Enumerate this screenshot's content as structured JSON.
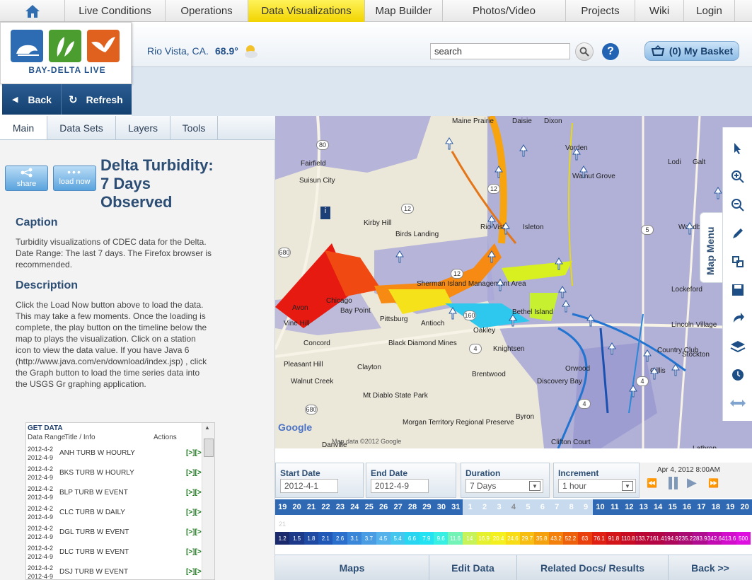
{
  "nav": {
    "items": [
      "Live Conditions",
      "Operations",
      "Data Visualizations",
      "Map Builder",
      "Photos/Video",
      "Projects",
      "Wiki",
      "Login"
    ],
    "active": "Data Visualizations"
  },
  "brand": {
    "name": "BAY-DELTA LIVE"
  },
  "header": {
    "location": "Rio Vista, CA.",
    "temperature": "68.9°",
    "search_placeholder": "search",
    "basket": "(0) My Basket"
  },
  "actions": {
    "back": "Back",
    "refresh": "Refresh"
  },
  "left_tabs": [
    "Main",
    "Data Sets",
    "Layers",
    "Tools"
  ],
  "buttons": {
    "share": "share",
    "load_now": "load now"
  },
  "main": {
    "title_line1": "Delta Turbidity:",
    "title_line2": "7 Days",
    "title_line3": "Observed",
    "caption_heading": "Caption",
    "caption_lines": [
      "Turbidity visualizations of CDEC data for the Delta.",
      "Date Range: The last 7 days. The Firefox browser is",
      "recommended."
    ],
    "description_heading": "Description",
    "description_lines": [
      "Click the Load Now button above to load the data.",
      "This may take a few moments. Once the loading is",
      "complete, the play button on the timeline below the",
      "map to plays the visualization. Click on a station",
      "icon to view the data value. If you have Java 6",
      "(http://www.java.com/en/download/index.jsp) , click",
      "the Graph button to load the time series data into",
      "the USGS Gr graphing application."
    ]
  },
  "get_data": {
    "title": "GET DATA",
    "columns": [
      "Data Range",
      "Title / Info",
      "Actions"
    ],
    "rows": [
      {
        "start": "2012-4-2",
        "end": "2012-4-9",
        "title": "ANH TURB W HOURLY",
        "action": "[>][>"
      },
      {
        "start": "2012-4-2",
        "end": "2012-4-9",
        "title": "BKS TURB W HOURLY",
        "action": "[>][>"
      },
      {
        "start": "2012-4-2",
        "end": "2012-4-9",
        "title": "BLP TURB W EVENT",
        "action": "[>][>"
      },
      {
        "start": "2012-4-2",
        "end": "2012-4-9",
        "title": "CLC TURB W DAILY",
        "action": "[>][>"
      },
      {
        "start": "2012-4-2",
        "end": "2012-4-9",
        "title": "DGL TURB W EVENT",
        "action": "[>][>"
      },
      {
        "start": "2012-4-2",
        "end": "2012-4-9",
        "title": "DLC TURB W EVENT",
        "action": "[>][>"
      },
      {
        "start": "2012-4-2",
        "end": "2012-4-9",
        "title": "DSJ TURB W EVENT",
        "action": "[>][>"
      }
    ]
  },
  "map": {
    "menu_label": "Map Menu",
    "attribution": "Map data ©2012 Google",
    "places": [
      "Maine Prairie",
      "Daisie",
      "Dixon",
      "Fairfield",
      "Suisun City",
      "Vorden",
      "Galt",
      "Kirby Hill",
      "Birds Landing",
      "Rio Vista",
      "Isleton",
      "Walnut Grove",
      "Sherman Island Management Area",
      "Bay Point",
      "Chicago",
      "Pittsburg",
      "Antioch",
      "Oakley",
      "Bethel Island",
      "Vine Hill",
      "Avon",
      "Concord",
      "Black Diamond Mines",
      "Knightsen",
      "Lodi",
      "Lockeford",
      "Lincoln Village",
      "Stockton",
      "Country Club",
      "Pleasant Hill",
      "Clayton",
      "Brentwood",
      "Orwood",
      "Discovery Bay",
      "Walnut Creek",
      "Mt Diablo State Park",
      "Byron",
      "Morgan Territory Regional Preserve",
      "Danville",
      "Clifton Court",
      "Lathrop",
      "Woodbridge",
      "Gillis"
    ],
    "highways": [
      "80",
      "12",
      "12",
      "12",
      "5",
      "160",
      "4",
      "4",
      "4",
      "680",
      "680"
    ]
  },
  "timeline": {
    "start_label": "Start Date",
    "start_value": "2012-4-1",
    "end_label": "End Date",
    "end_value": "2012-4-9",
    "duration_label": "Duration",
    "duration_value": "7 Days",
    "increment_label": "Increment",
    "increment_value": "1 hour",
    "current_time": "Apr 4, 2012 8:00AM",
    "days_before": [
      "19",
      "20",
      "21",
      "22",
      "23",
      "24",
      "25",
      "26",
      "27",
      "28",
      "29",
      "30",
      "31"
    ],
    "days_range": [
      "1",
      "2",
      "3",
      "4",
      "5",
      "6",
      "7",
      "8",
      "9"
    ],
    "days_after": [
      "10",
      "11",
      "12",
      "13",
      "14",
      "15",
      "16",
      "17",
      "18",
      "19",
      "20"
    ],
    "current_day": "4",
    "hour_marker": "21"
  },
  "legend": {
    "values": [
      "1.2",
      "1.5",
      "1.8",
      "2.1",
      "2.6",
      "3.1",
      "3.7",
      "4.5",
      "5.4",
      "6.6",
      "7.9",
      "9.6",
      "11.6",
      "14",
      "16.9",
      "20.4",
      "24.6",
      "29.7",
      "35.8",
      "43.2",
      "52.2",
      "63",
      "76.1",
      "91.8",
      "110.8",
      "133.7",
      "161.4",
      "194.9",
      "235.2",
      "283.9",
      "342.6",
      "413.6",
      "500"
    ],
    "colors": [
      "#1a2a6c",
      "#1d3a8a",
      "#1f4aa3",
      "#2058b8",
      "#2a6fcb",
      "#3a86d8",
      "#4a9ce3",
      "#55b2ea",
      "#44c6ee",
      "#29d6f2",
      "#23e3f2",
      "#37efe3",
      "#74f3b7",
      "#c7f25a",
      "#e5f12e",
      "#f4f01f",
      "#f8dc15",
      "#f7be11",
      "#f5a00d",
      "#f2800b",
      "#ee610b",
      "#e9400d",
      "#e02012",
      "#d31418",
      "#c70c24",
      "#bb0733",
      "#b40645",
      "#ae085a",
      "#aa0b72",
      "#b00c8f",
      "#c20bb0",
      "#d20dcc",
      "#de10e0"
    ]
  },
  "bottom": {
    "maps": "Maps",
    "edit_data": "Edit Data",
    "related": "Related Docs/ Results",
    "back": "Back >>"
  }
}
